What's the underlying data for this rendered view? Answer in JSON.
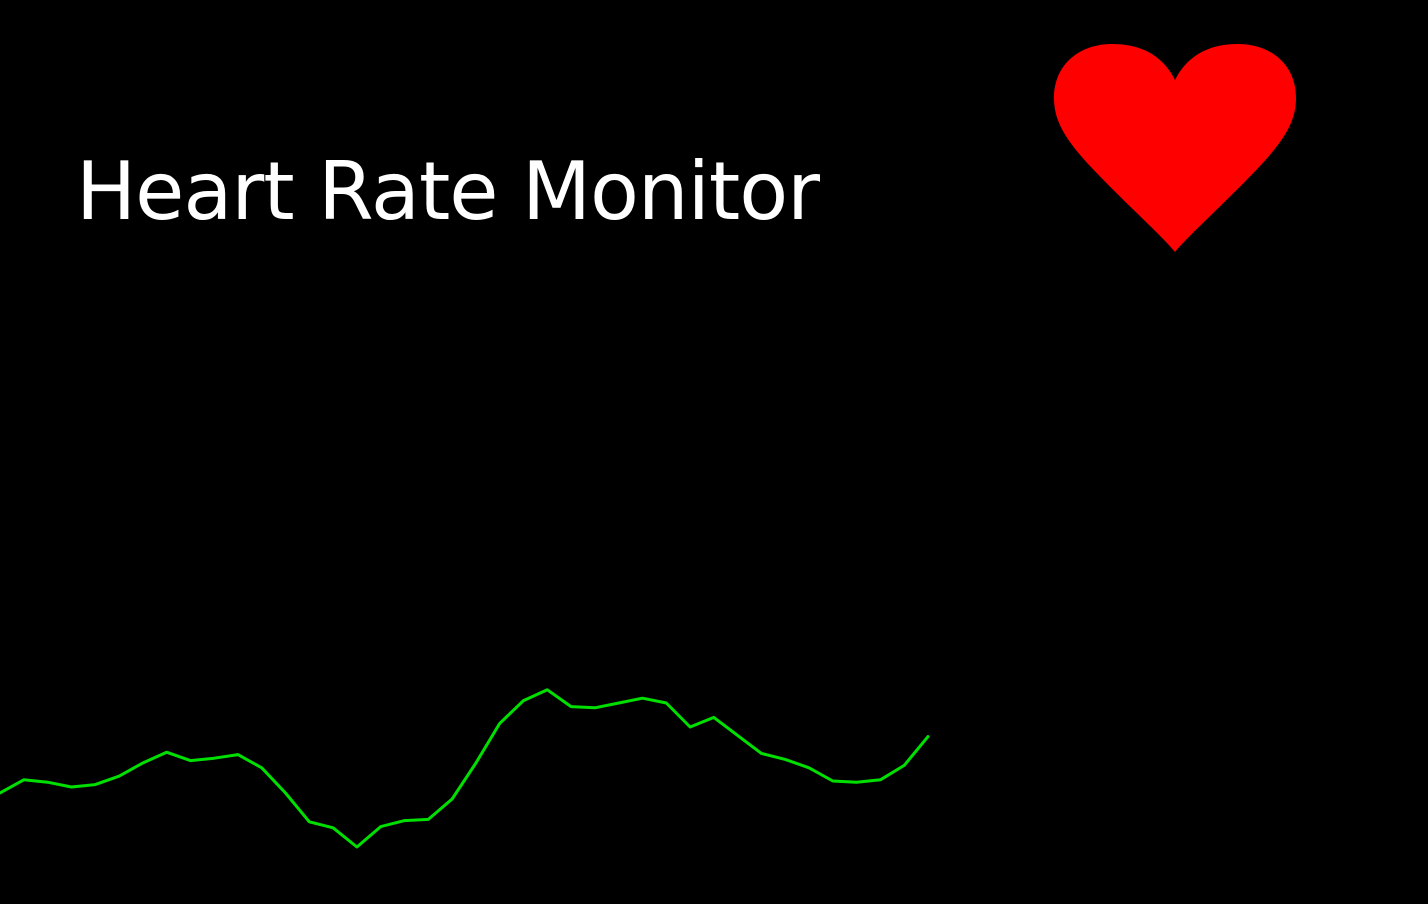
{
  "app": {
    "title": "Heart Rate Monitor"
  },
  "heart": {
    "icon": "heart-icon",
    "color": "#ff0000"
  },
  "waveform": {
    "color": "#00e000"
  },
  "chart_data": {
    "type": "line",
    "series": [
      {
        "values": [
          60.0,
          61.1,
          60.9,
          60.5,
          60.7,
          61.4,
          62.5,
          63.4,
          62.7,
          62.9,
          63.2,
          62.1,
          60.0,
          57.6,
          57.1,
          55.5,
          57.2,
          57.7,
          57.8,
          59.5,
          62.5,
          65.8,
          67.7,
          68.6,
          67.2,
          67.1,
          67.5,
          67.9,
          67.5,
          65.5,
          66.3,
          64.8,
          63.3,
          62.8,
          62.1,
          61.0,
          60.9,
          61.1,
          62.3,
          64.7
        ]
      }
    ]
  }
}
